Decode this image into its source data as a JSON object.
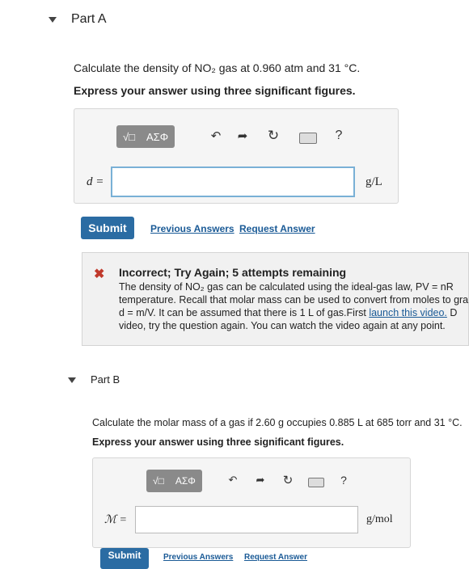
{
  "part_a": {
    "title": "Part A",
    "question": "Calculate the density of NO₂ gas at 0.960 atm and 31 °C.",
    "instruction": "Express your answer using three significant figures.",
    "toolbar": {
      "templates_label": "√□",
      "greek_label": "ΑΣΦ",
      "help_label": "?"
    },
    "variable_label": "d =",
    "input_value": "",
    "unit": "g/L",
    "submit_label": "Submit",
    "previous_answers_label": "Previous Answers",
    "request_answer_label": "Request Answer",
    "feedback": {
      "title": "Incorrect; Try Again; 5 attempts remaining",
      "line1": "The density of NO₂ gas can be calculated using the ideal-gas law, PV = nR",
      "line2": "temperature. Recall that molar mass can be used to convert from moles to grar",
      "line3a": "d = m/V. It can be assumed that there is 1 L of gas.First ",
      "link": "launch this video.",
      "line3b": " D",
      "line4": "video, try the question again. You can watch the video again at any point."
    }
  },
  "part_b": {
    "title": "Part B",
    "question": "Calculate the molar mass of a gas if 2.60 g occupies 0.885 L at 685 torr and 31 °C.",
    "instruction": "Express your answer using three significant figures.",
    "toolbar": {
      "templates_label": "√□",
      "greek_label": "ΑΣΦ",
      "help_label": "?"
    },
    "variable_label": "ℳ =",
    "input_value": "",
    "unit": "g/mol",
    "submit_label": "Submit",
    "previous_answers_label": "Previous Answers",
    "request_answer_label": "Request Answer"
  }
}
